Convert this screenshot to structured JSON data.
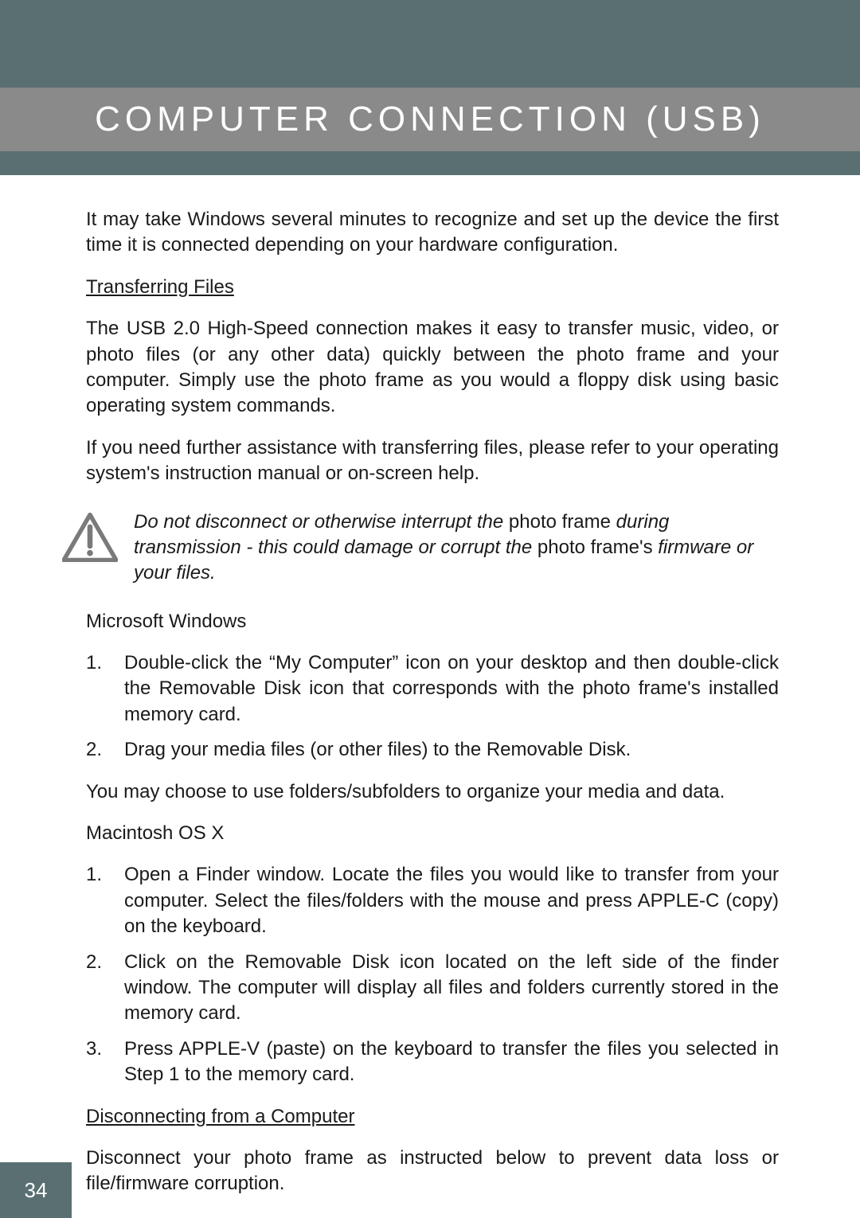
{
  "header": {
    "title": "COMPUTER CONNECTION (USB)"
  },
  "intro": "It may take Windows several minutes to recognize and set up the device the first time it is connected depending on your hardware configuration.",
  "transferring": {
    "heading": "Transferring Files",
    "p1": "The USB 2.0 High-Speed connection makes it easy to transfer music, video, or photo files (or any other data) quickly between the photo frame and your computer. Simply use the photo frame as you would a floppy disk using basic operating system commands.",
    "p2": "If you need further assistance with transferring files, please refer to your operating system's instruction manual or on-screen help."
  },
  "warning": {
    "pre": "Do not disconnect or otherwise interrupt the ",
    "up1": "photo frame",
    "mid": " during transmission - this could damage or corrupt the ",
    "up2": "photo frame's",
    "post": " firmware or your files."
  },
  "windows": {
    "heading": "Microsoft Windows",
    "steps": [
      "Double-click the “My Computer” icon on your desktop and then double-click the Removable Disk icon that corresponds with the photo frame's installed memory card.",
      "Drag your media files (or other files) to the Removable Disk."
    ],
    "note": "You may choose to use folders/subfolders to organize your media and data."
  },
  "mac": {
    "heading": "Macintosh OS X",
    "steps": [
      "Open a Finder window. Locate the files you would like to transfer from your computer. Select the files/folders with the mouse and press APPLE-C (copy) on the keyboard.",
      "Click on the Removable Disk icon located on the left side of the finder window. The computer will display all files and folders currently stored in the memory card.",
      "Press APPLE-V (paste) on the keyboard to transfer the files you selected in Step 1 to the memory card."
    ]
  },
  "disconnect": {
    "heading": "Disconnecting from a Computer",
    "p1": "Disconnect your photo frame as instructed below to prevent data loss or file/firmware corruption."
  },
  "pageNumber": "34"
}
